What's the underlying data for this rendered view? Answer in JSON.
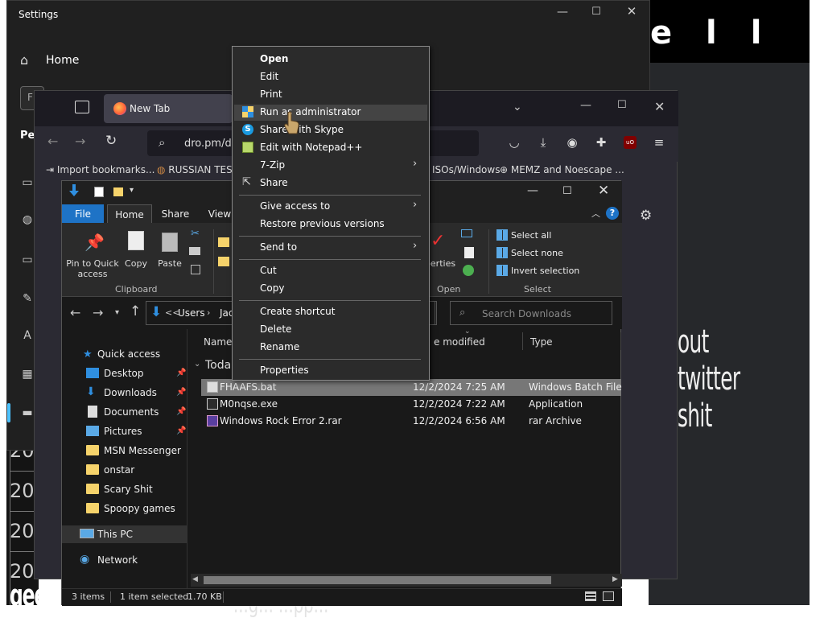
{
  "colors": {
    "accent_blue": "#1e73c6",
    "folder_yellow": "#f6d36b",
    "menu_bg": "#2b2b2b",
    "selection_row": "#777777",
    "settings_accent": "#4cc2ff"
  },
  "background": {
    "logo_text": "e l l",
    "caption_text": "out twitter shit",
    "left_numbers": [
      "20",
      "20",
      "20",
      "20"
    ],
    "watermark_text": "geekba",
    "bottom_caption": "...g... ...pp..."
  },
  "settings": {
    "title": "Settings",
    "home_label": "Home",
    "search_placeholder": "F",
    "section_label": "Per",
    "sidebar_icons": [
      "image-icon",
      "palette-icon",
      "monitor-icon",
      "pen-icon",
      "language-icon",
      "grid-icon",
      "keyboard-icon"
    ]
  },
  "browser": {
    "tab_label": "New Tab",
    "url_text": "dro.pm/d7",
    "bookmarks": [
      "Import bookmarks...",
      "RUSSIAN TEST",
      "ISOs/Windows",
      "MEMZ and Noescape ..."
    ],
    "ublock_label": "uO"
  },
  "explorer": {
    "tabs": {
      "file": "File",
      "home": "Home",
      "share": "Share",
      "view": "View"
    },
    "help_label": "?",
    "ribbon": {
      "pin_label_1": "Pin to Quick",
      "pin_label_2": "access",
      "copy_label": "Copy",
      "paste_label": "Paste",
      "clipboard_group": "Clipboard",
      "properties_label": "perties",
      "open_group": "Open",
      "select_all": "Select all",
      "select_none": "Select none",
      "invert_selection": "Invert selection",
      "select_group": "Select"
    },
    "address": {
      "sep": "<<",
      "crumb_users": "Users",
      "sep2": "›",
      "crumb_jac": "Jac"
    },
    "search_placeholder": "Search Downloads",
    "nav": [
      {
        "label": "Quick access",
        "type": "star"
      },
      {
        "label": "Desktop",
        "type": "desktop",
        "pinned": true
      },
      {
        "label": "Downloads",
        "type": "download",
        "pinned": true
      },
      {
        "label": "Documents",
        "type": "doc",
        "pinned": true
      },
      {
        "label": "Pictures",
        "type": "pic",
        "pinned": true
      },
      {
        "label": "MSN Messenger",
        "type": "folder"
      },
      {
        "label": "onstar",
        "type": "folder"
      },
      {
        "label": "Scary Shit",
        "type": "folder"
      },
      {
        "label": "Spoopy games",
        "type": "folder"
      },
      {
        "label": "This PC",
        "type": "pc"
      },
      {
        "label": "Network",
        "type": "network"
      }
    ],
    "columns": {
      "name": "Name",
      "modified": "e modified",
      "type": "Type"
    },
    "group_label": "Toda",
    "files": [
      {
        "name": "FHAAFS.bat",
        "date": "12/2/2024 7:25 AM",
        "type": "Windows Batch File",
        "selected": true
      },
      {
        "name": "M0nqse.exe",
        "date": "12/2/2024 7:22 AM",
        "type": "Application",
        "selected": false
      },
      {
        "name": "Windows Rock Error 2.rar",
        "date": "12/2/2024 6:56 AM",
        "type": "rar Archive",
        "selected": false
      }
    ],
    "status": {
      "items": "3 items",
      "selected": "1 item selected",
      "size": "1.70 KB"
    }
  },
  "context_menu": {
    "open": "Open",
    "edit": "Edit",
    "print": "Print",
    "run_as_admin": "Run as administrator",
    "share_skype": "Share with Skype",
    "edit_notepad": "Edit with Notepad++",
    "zip": "7-Zip",
    "share": "Share",
    "give_access": "Give access to",
    "restore": "Restore previous versions",
    "send_to": "Send to",
    "cut": "Cut",
    "copy": "Copy",
    "create_shortcut": "Create shortcut",
    "delete": "Delete",
    "rename": "Rename",
    "properties": "Properties"
  }
}
